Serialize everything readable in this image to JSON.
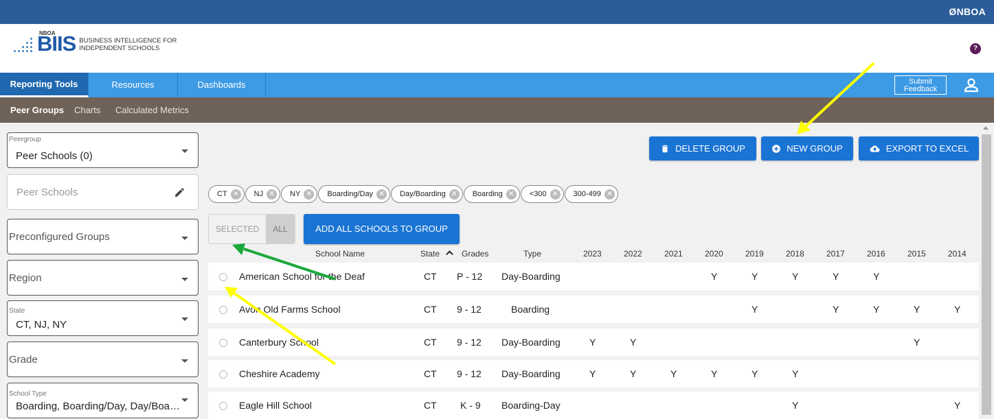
{
  "topbar": {
    "brand": "ØNBOA"
  },
  "logo": {
    "org": "NBOA",
    "name": "BIIS",
    "tagline_1": "BUSINESS INTELLIGENCE FOR",
    "tagline_2": "INDEPENDENT SCHOOLS"
  },
  "help": {
    "label": "?"
  },
  "nav": {
    "tabs": [
      {
        "label": "Reporting Tools"
      },
      {
        "label": "Resources"
      },
      {
        "label": "Dashboards"
      }
    ],
    "feedback_1": "Submit",
    "feedback_2": "Feedback",
    "user_icon": "user-icon"
  },
  "subnav": {
    "items": [
      {
        "label": "Peer Groups"
      },
      {
        "label": "Charts"
      },
      {
        "label": "Calculated Metrics"
      }
    ]
  },
  "sidebar": {
    "peergroup": {
      "label": "Peergroup",
      "value": "Peer Schools (0)"
    },
    "peer_schools": {
      "placeholder": "Peer Schools",
      "icon": "pencil-icon"
    },
    "preconfigured": {
      "placeholder": "Preconfigured Groups"
    },
    "region": {
      "placeholder": "Region"
    },
    "state": {
      "label": "State",
      "value": "CT, NJ, NY"
    },
    "grade": {
      "placeholder": "Grade"
    },
    "school_type": {
      "label": "School Type",
      "value": "Boarding, Boarding/Day, Day/Boa…"
    }
  },
  "actions": {
    "delete": {
      "label": "DELETE GROUP",
      "icon": "trash-icon"
    },
    "new": {
      "label": "NEW GROUP",
      "icon": "plus-circle-icon"
    },
    "export": {
      "label": "EXPORT TO EXCEL",
      "icon": "cloud-upload-icon"
    }
  },
  "filters": [
    "CT",
    "NJ",
    "NY",
    "Boarding/Day",
    "Day/Boarding",
    "Boarding",
    "<300",
    "300-499"
  ],
  "toggle": {
    "selected": "SELECTED",
    "all": "ALL"
  },
  "add_all": "ADD ALL SCHOOLS TO GROUP",
  "table": {
    "headers": {
      "school": "School Name",
      "state": "State",
      "grades": "Grades",
      "type": "Type",
      "years": [
        "2023",
        "2022",
        "2021",
        "2020",
        "2019",
        "2018",
        "2017",
        "2016",
        "2015",
        "2014"
      ]
    },
    "sort_icon": "sort-ascending-icon",
    "rows": [
      {
        "name": "American School for the Deaf",
        "state": "CT",
        "grades": "P - 12",
        "type": "Day-Boarding",
        "years": [
          "",
          "",
          "",
          "Y",
          "Y",
          "Y",
          "Y",
          "Y",
          "",
          ""
        ]
      },
      {
        "name": "Avon Old Farms School",
        "state": "CT",
        "grades": "9 - 12",
        "type": "Boarding",
        "years": [
          "",
          "",
          "",
          "",
          "Y",
          "",
          "Y",
          "Y",
          "Y",
          "Y"
        ]
      },
      {
        "name": "Canterbury School",
        "state": "CT",
        "grades": "9 - 12",
        "type": "Day-Boarding",
        "years": [
          "Y",
          "Y",
          "",
          "",
          "",
          "",
          "",
          "",
          "Y",
          ""
        ]
      },
      {
        "name": "Cheshire Academy",
        "state": "CT",
        "grades": "9 - 12",
        "type": "Day-Boarding",
        "years": [
          "Y",
          "Y",
          "Y",
          "Y",
          "Y",
          "Y",
          "",
          "",
          "",
          ""
        ]
      },
      {
        "name": "Eagle Hill School",
        "state": "CT",
        "grades": "K - 9",
        "type": "Boarding-Day",
        "years": [
          "",
          "",
          "",
          "",
          "",
          "Y",
          "",
          "",
          "",
          "Y"
        ]
      }
    ]
  },
  "annotations": {
    "arrow_color_1": "#ffff00",
    "arrow_color_2": "#1aa83a"
  }
}
